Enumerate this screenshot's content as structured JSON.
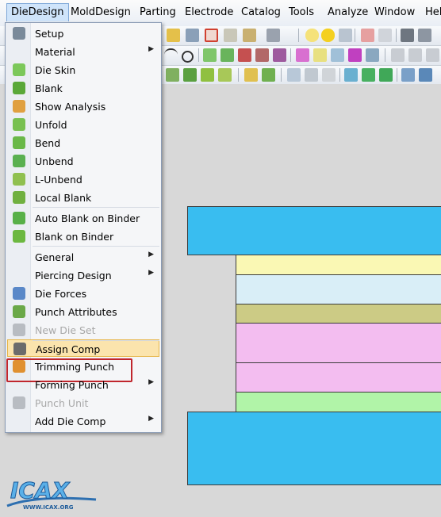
{
  "menubar": {
    "items": [
      "DieDesign",
      "MoldDesign",
      "Parting",
      "Electrode",
      "Catalog",
      "Tools",
      "Analyze",
      "Window",
      "Hel"
    ]
  },
  "menu": {
    "items": [
      {
        "label": "Setup",
        "icon": "setup-icon",
        "submenu": false,
        "disabled": false
      },
      {
        "label": "Material",
        "icon": "",
        "submenu": true,
        "disabled": false
      },
      {
        "label": "Die Skin",
        "icon": "die-skin-icon",
        "submenu": false,
        "disabled": false
      },
      {
        "label": "Blank",
        "icon": "blank-icon",
        "submenu": false,
        "disabled": false
      },
      {
        "label": "Show Analysis",
        "icon": "show-analysis-icon",
        "submenu": false,
        "disabled": false
      },
      {
        "label": "Unfold",
        "icon": "unfold-icon",
        "submenu": false,
        "disabled": false
      },
      {
        "label": "Bend",
        "icon": "bend-icon",
        "submenu": false,
        "disabled": false
      },
      {
        "label": "Unbend",
        "icon": "unbend-icon",
        "submenu": false,
        "disabled": false
      },
      {
        "label": "L-Unbend",
        "icon": "l-unbend-icon",
        "submenu": false,
        "disabled": false
      },
      {
        "label": "Local Blank",
        "icon": "local-blank-icon",
        "submenu": false,
        "disabled": false
      },
      {
        "label": "Auto Blank on Binder",
        "icon": "auto-blank-icon",
        "submenu": false,
        "disabled": false
      },
      {
        "label": "Blank on Binder",
        "icon": "blank-on-binder-icon",
        "submenu": false,
        "disabled": false
      },
      {
        "label": "General",
        "icon": "",
        "submenu": true,
        "disabled": false
      },
      {
        "label": "Piercing Design",
        "icon": "",
        "submenu": true,
        "disabled": false
      },
      {
        "label": "Die Forces",
        "icon": "die-forces-icon",
        "submenu": false,
        "disabled": false
      },
      {
        "label": "Punch Attributes",
        "icon": "punch-attributes-icon",
        "submenu": false,
        "disabled": false
      },
      {
        "label": "New Die Set",
        "icon": "new-die-set-icon",
        "submenu": false,
        "disabled": true
      },
      {
        "label": "Assign Comp",
        "icon": "assign-comp-icon",
        "submenu": false,
        "disabled": false
      },
      {
        "label": "Trimming Punch",
        "icon": "trimming-punch-icon",
        "submenu": false,
        "disabled": false
      },
      {
        "label": "Forming Punch",
        "icon": "",
        "submenu": true,
        "disabled": false
      },
      {
        "label": "Punch Unit",
        "icon": "punch-unit-icon",
        "submenu": false,
        "disabled": true
      },
      {
        "label": "Add Die Comp",
        "icon": "",
        "submenu": true,
        "disabled": false
      }
    ]
  },
  "logo": {
    "text": "ICAX",
    "url_text": "WWW.ICAX.ORG"
  },
  "colors": {
    "plate_blue": "#39bdf0",
    "plate_yellow": "#faf8b4",
    "plate_lightblue": "#d9eef7",
    "plate_olive": "#cccb85",
    "plate_pink": "#f3bdf0",
    "plate_green": "#b1f4a8",
    "highlight": "#fbe4ad",
    "callout_red": "#c0262d"
  }
}
